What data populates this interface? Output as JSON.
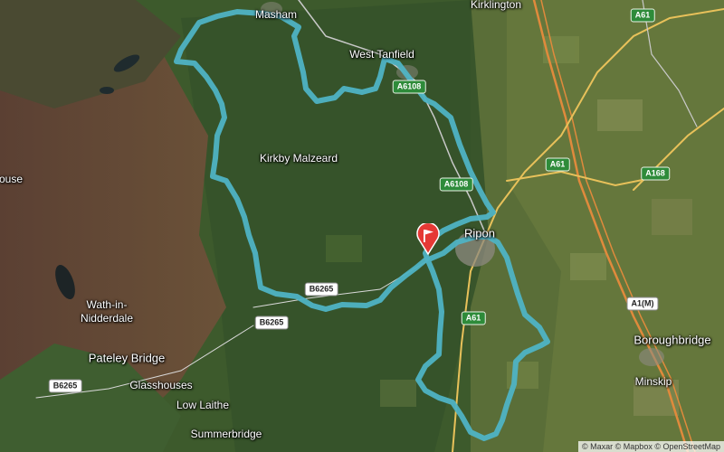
{
  "map": {
    "places": [
      {
        "id": "masham",
        "label": "Masham"
      },
      {
        "id": "kirklington",
        "label": "Kirklington"
      },
      {
        "id": "west-tanfield",
        "label": "West Tanfield"
      },
      {
        "id": "kirkby-malzeard",
        "label": "Kirkby Malzeard"
      },
      {
        "id": "ripon",
        "label": "Ripon"
      },
      {
        "id": "ouse",
        "label": "ouse"
      },
      {
        "id": "wath-in-nidderdale",
        "label": "Wath-in-\nNidderdale"
      },
      {
        "id": "pateley-bridge",
        "label": "Pateley Bridge"
      },
      {
        "id": "glasshouses",
        "label": "Glasshouses"
      },
      {
        "id": "low-laithe",
        "label": "Low Laithe"
      },
      {
        "id": "summerbridge",
        "label": "Summerbridge"
      },
      {
        "id": "boroughbridge",
        "label": "Boroughbridge"
      },
      {
        "id": "minskip",
        "label": "Minskip"
      }
    ],
    "road_shields": [
      {
        "id": "a61-top",
        "label": "A61",
        "style": "green"
      },
      {
        "id": "a6108-top",
        "label": "A6108",
        "style": "green"
      },
      {
        "id": "a6108-mid",
        "label": "A6108",
        "style": "green"
      },
      {
        "id": "a61-mid",
        "label": "A61",
        "style": "green"
      },
      {
        "id": "a168",
        "label": "A168",
        "style": "green"
      },
      {
        "id": "a1m",
        "label": "A1(M)",
        "style": "white"
      },
      {
        "id": "a61-low",
        "label": "A61",
        "style": "green"
      },
      {
        "id": "b6265-a",
        "label": "B6265",
        "style": "white"
      },
      {
        "id": "b6265-b",
        "label": "B6265",
        "style": "white"
      },
      {
        "id": "b6265-c",
        "label": "B6265",
        "style": "white"
      }
    ],
    "route": {
      "color": "#4fb3c4",
      "marker": "flag-pin-icon",
      "marker_color": "#e53935"
    },
    "attribution": "© Maxar © Mapbox © OpenStreetMap"
  }
}
